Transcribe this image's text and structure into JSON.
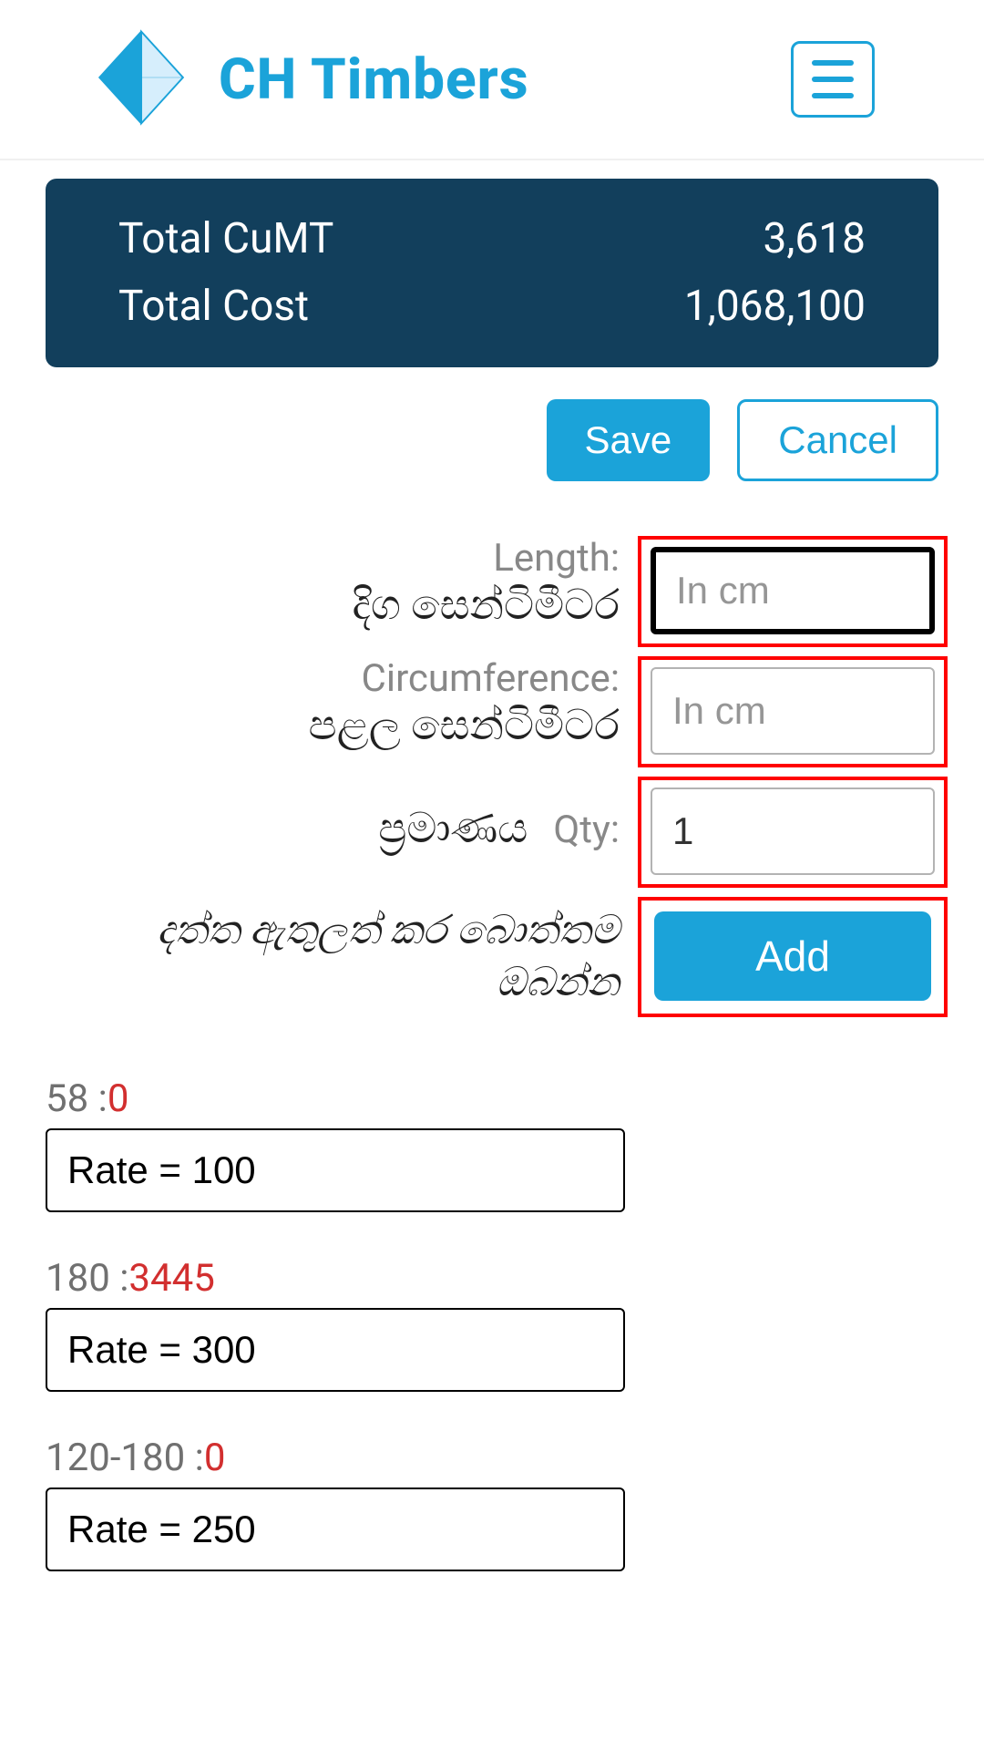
{
  "header": {
    "brand_name": "CH Timbers"
  },
  "summary": {
    "total_cumt_label": "Total CuMT",
    "total_cumt_value": "3,618",
    "total_cost_label": "Total Cost",
    "total_cost_value": "1,068,100"
  },
  "actions": {
    "save_label": "Save",
    "cancel_label": "Cancel"
  },
  "form": {
    "length": {
      "label_en": "Length:",
      "label_sn": "දිග සෙන්ටිමීටර",
      "placeholder": "In cm",
      "value": ""
    },
    "circumference": {
      "label_en": "Circumference:",
      "label_sn": "පළල සෙන්ටිමීටර",
      "placeholder": "In cm",
      "value": ""
    },
    "qty": {
      "label_en": "Qty:",
      "label_sn": "ප්‍රමාණය",
      "value": "1"
    },
    "add": {
      "label_sn": "දත්ත ඇතුලත් කර බොත්තම ඔබන්න",
      "button_label": "Add"
    }
  },
  "rates": [
    {
      "range": "58 :",
      "count": "0",
      "rate_text": "Rate = 100"
    },
    {
      "range": "180 :",
      "count": "3445",
      "rate_text": "Rate = 300"
    },
    {
      "range": "120-180 :",
      "count": "0",
      "rate_text": "Rate = 250"
    }
  ]
}
